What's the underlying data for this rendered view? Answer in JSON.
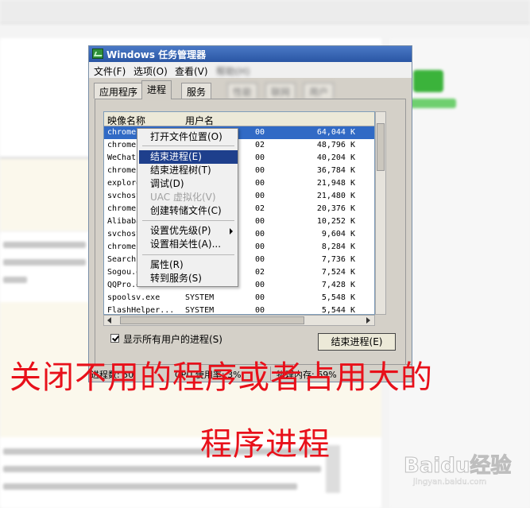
{
  "window": {
    "title": "Windows 任务管理器",
    "menu": [
      {
        "label": "文件(F)"
      },
      {
        "label": "选项(O)"
      },
      {
        "label": "查看(V)"
      },
      {
        "label": "帮助(H)"
      }
    ],
    "tabs": [
      {
        "label": "应用程序"
      },
      {
        "label": "进程"
      },
      {
        "label": "服务"
      },
      {
        "label": "性能"
      },
      {
        "label": "联网"
      },
      {
        "label": "用户"
      }
    ],
    "columns": {
      "name": "映像名称",
      "user": "用户名"
    },
    "processes": [
      {
        "name": "chrome.exe",
        "user": "",
        "cpu": "00",
        "mem": "64,044 K"
      },
      {
        "name": "chrome.exe",
        "user": "",
        "cpu": "02",
        "mem": "48,796 K"
      },
      {
        "name": "WeChat.exe",
        "user": "",
        "cpu": "00",
        "mem": "40,204 K"
      },
      {
        "name": "chrome.exe",
        "user": "",
        "cpu": "00",
        "mem": "36,784 K"
      },
      {
        "name": "explorer.exe",
        "user": "",
        "cpu": "00",
        "mem": "21,948 K"
      },
      {
        "name": "svchost.exe",
        "user": "",
        "cpu": "00",
        "mem": "21,480 K"
      },
      {
        "name": "chrome.exe",
        "user": "",
        "cpu": "02",
        "mem": "20,376 K"
      },
      {
        "name": "Alibaba.exe",
        "user": "",
        "cpu": "00",
        "mem": "10,252 K"
      },
      {
        "name": "svchost.exe",
        "user": "",
        "cpu": "00",
        "mem": "9,604 K"
      },
      {
        "name": "chrome.exe",
        "user": "",
        "cpu": "00",
        "mem": "8,284 K"
      },
      {
        "name": "Search.exe",
        "user": "",
        "cpu": "00",
        "mem": "7,736 K"
      },
      {
        "name": "Sogou.exe",
        "user": "",
        "cpu": "02",
        "mem": "7,524 K"
      },
      {
        "name": "QQPro.exe",
        "user": "",
        "cpu": "00",
        "mem": "7,428 K"
      },
      {
        "name": "spoolsv.exe",
        "user": "SYSTEM",
        "cpu": "00",
        "mem": "5,548 K"
      },
      {
        "name": "FlashHelper...",
        "user": "SYSTEM",
        "cpu": "00",
        "mem": "5,544 K"
      }
    ],
    "show_all_users": "显示所有用户的进程(S)",
    "end_process_button": "结束进程(E)",
    "status": {
      "processes": "进程数: 50",
      "cpu": "CPU 使用率: 3%",
      "memory": "物理内存: 69%"
    }
  },
  "context_menu": {
    "items": [
      {
        "label": "打开文件位置(O)"
      },
      {
        "label": "结束进程(E)"
      },
      {
        "label": "结束进程树(T)"
      },
      {
        "label": "调试(D)"
      },
      {
        "label": "UAC 虚拟化(V)"
      },
      {
        "label": "创建转储文件(C)"
      },
      {
        "label": "设置优先级(P)"
      },
      {
        "label": "设置相关性(A)..."
      },
      {
        "label": "属性(R)"
      },
      {
        "label": "转到服务(S)"
      }
    ]
  },
  "caption": {
    "line1": "关闭不用的程序或者占用大的",
    "line2": "程序进程"
  },
  "watermark": {
    "logo": "Baidu经验",
    "url": "jingyan.baidu.com"
  }
}
